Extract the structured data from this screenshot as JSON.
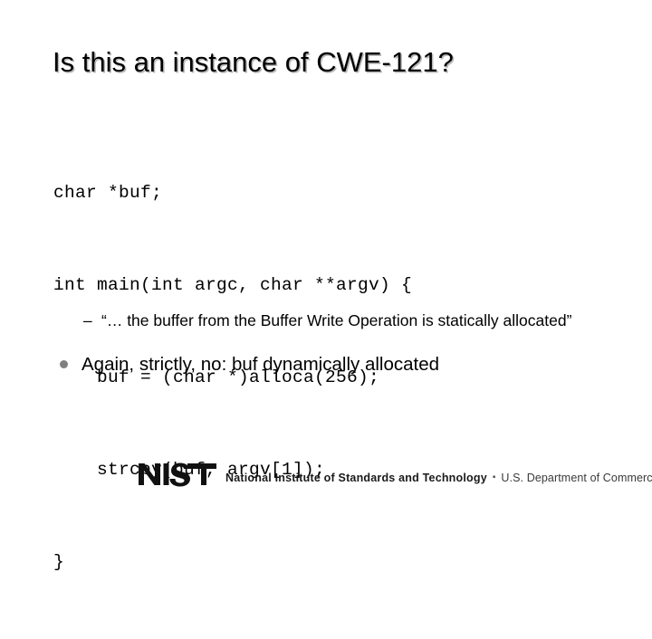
{
  "slide": {
    "title": "Is this an instance of CWE-121?",
    "background_color": "#ffffff",
    "text_color": "#000000",
    "title_shadow_color": "#b8b8b8"
  },
  "code": {
    "language": "c",
    "lines": [
      "char *buf;",
      "int main(int argc, char **argv) {",
      "    buf = (char *)alloca(256);",
      "    strcpy(buf, argv[1]);",
      "}"
    ]
  },
  "bullets": {
    "sub": {
      "marker": "–",
      "text": "“… the buffer from the Buffer Write Operation is statically allocated”"
    },
    "main": {
      "marker": "bullet-dot",
      "marker_color": "#808080",
      "text": "Again, strictly, no: buf dynamically allocated"
    }
  },
  "footer": {
    "logo_text": "NIST",
    "agency": "National Institute of Standards and Technology",
    "separator": "▪",
    "department": "U.S. Department of Commerce"
  }
}
